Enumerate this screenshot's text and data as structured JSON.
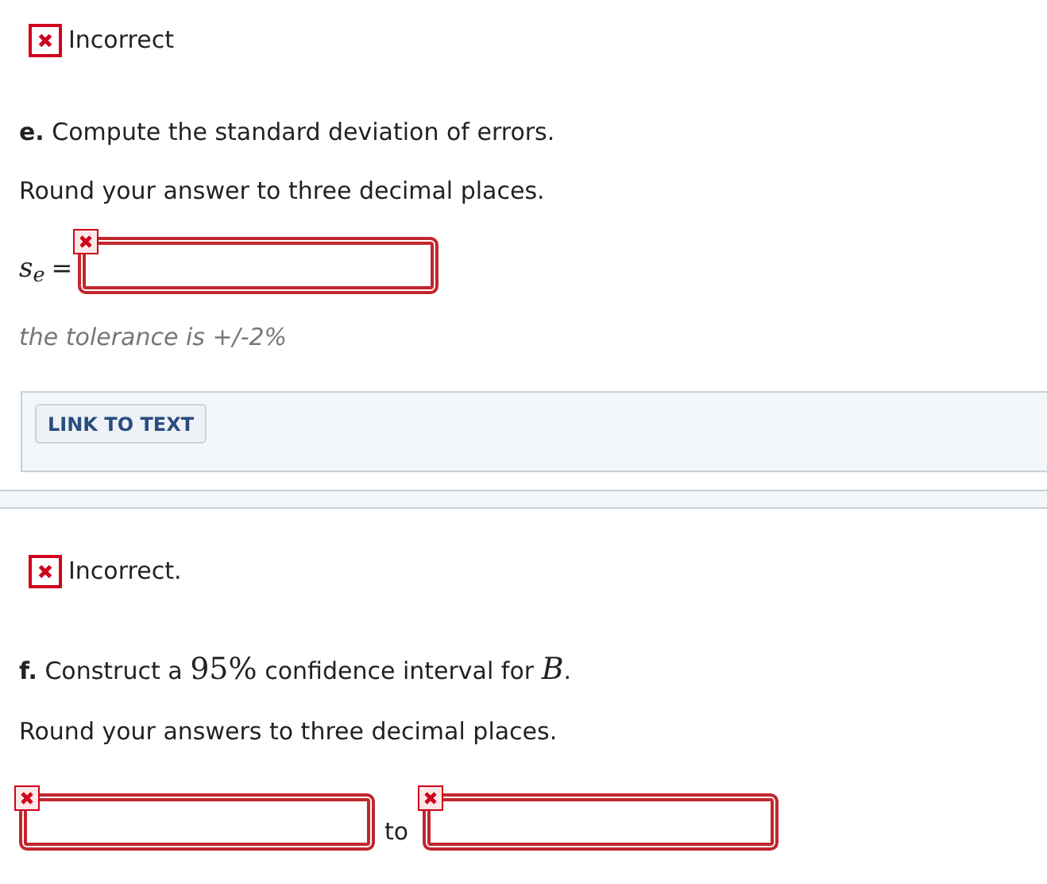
{
  "part_e": {
    "feedback": {
      "kind": "incorrect",
      "text": "Incorrect"
    },
    "question": {
      "label": "e.",
      "segments": [
        {
          "kind": "text",
          "text": "Compute the standard deviation of errors."
        }
      ]
    },
    "instruction": "Round your answer to three decimal places.",
    "answer": {
      "label": "s$_{e}$",
      "equals": "=",
      "fields": [
        {
          "incorrect": true
        }
      ]
    },
    "tolerance": "the tolerance is +/-2%",
    "link_button": "LINK TO TEXT"
  },
  "part_f": {
    "feedback": {
      "kind": "incorrect",
      "text": "Incorrect."
    },
    "question": {
      "label": "f.",
      "segments": [
        {
          "kind": "text",
          "text": "Construct a "
        },
        {
          "kind": "math",
          "text": "95%"
        },
        {
          "kind": "text",
          "text": " confidence interval for "
        },
        {
          "kind": "math_italic",
          "text": "B"
        },
        {
          "kind": "text",
          "text": "."
        }
      ]
    },
    "instruction": "Round your answers to three decimal places.",
    "answer": {
      "fields": [
        {
          "incorrect": true
        },
        {
          "incorrect": true
        }
      ],
      "separator": "to"
    }
  }
}
